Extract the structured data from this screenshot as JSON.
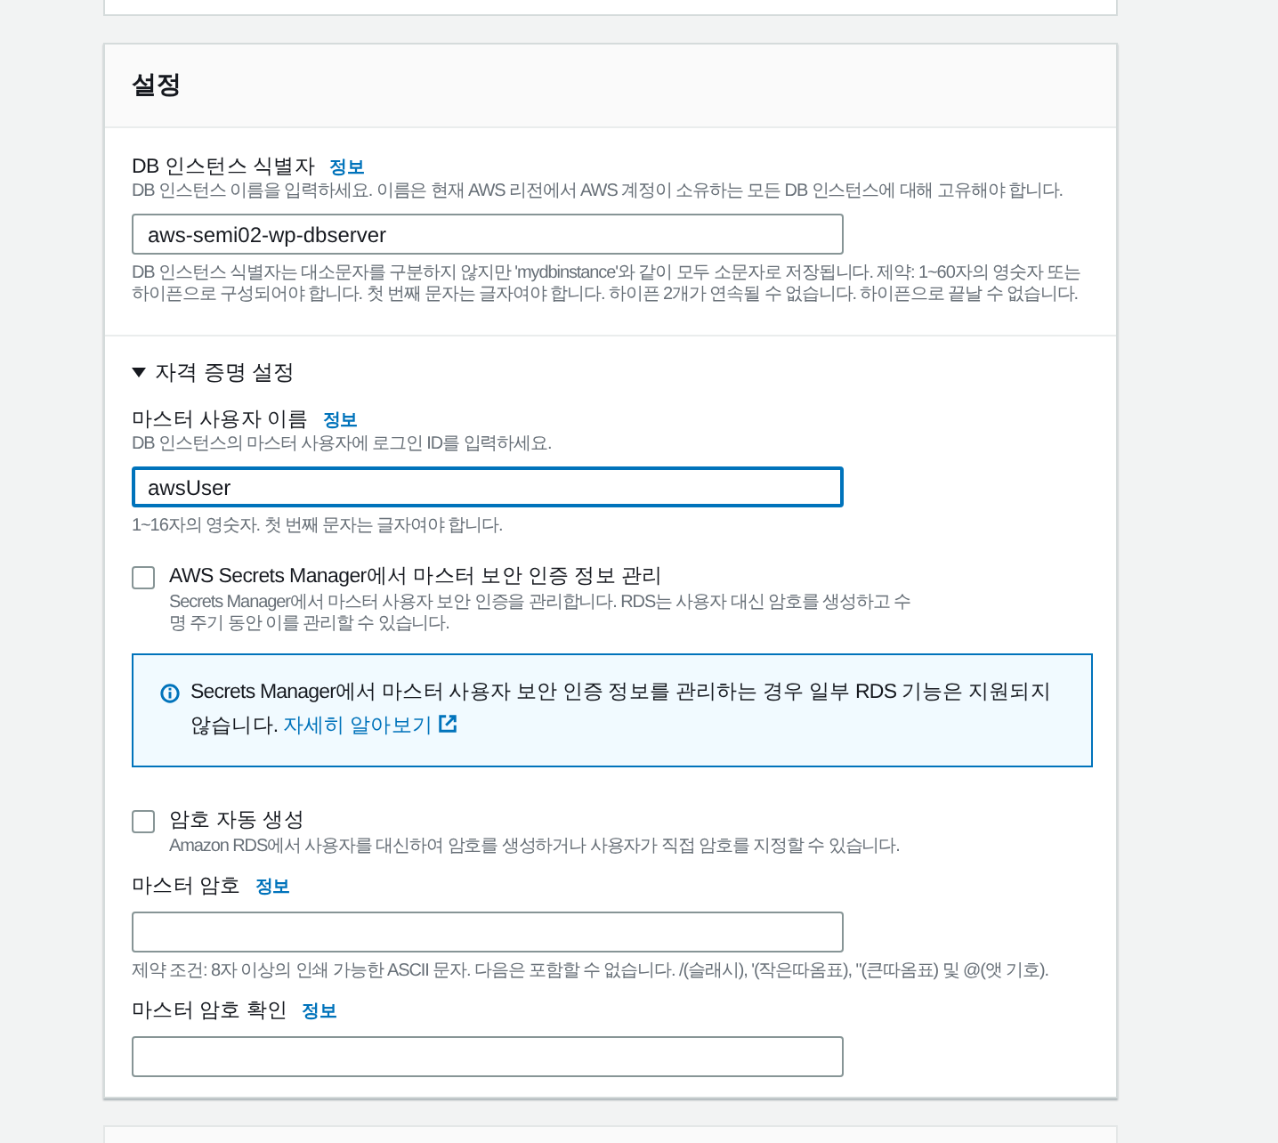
{
  "settings": {
    "title": "설정",
    "instance_identifier": {
      "label": "DB 인스턴스 식별자",
      "info": "정보",
      "description": "DB 인스턴스 이름을 입력하세요. 이름은 현재 AWS 리전에서 AWS 계정이 소유하는 모든 DB 인스턴스에 대해 고유해야 합니다.",
      "value": "aws-semi02-wp-dbserver",
      "focused": false,
      "constraint": "DB 인스턴스 식별자는 대소문자를 구분하지 않지만 'mydbinstance'와 같이 모두 소문자로 저장됩니다. 제약: 1~60자의 영숫자 또는 하이픈으로 구성되어야 합니다. 첫 번째 문자는 글자여야 합니다. 하이픈 2개가 연속될 수 없습니다. 하이픈으로 끝날 수 없습니다."
    },
    "credentials": {
      "title": "자격 증명 설정",
      "expanded": true,
      "items": [
        {
          "kind": "field",
          "label": "마스터 사용자 이름",
          "info": "정보",
          "description": "DB 인스턴스의 마스터 사용자에 로그인 ID를 입력하세요.",
          "value": "awsUser",
          "focused": true,
          "constraint": "1~16자의 영숫자. 첫 번째 문자는 글자여야 합니다."
        },
        {
          "kind": "checkbox",
          "label": "AWS Secrets Manager에서 마스터 보안 인증 정보 관리",
          "checked": false,
          "description": "Secrets Manager에서 마스터 사용자 보안 인증을 관리합니다. RDS는 사용자 대신 암호를 생성하고 수명 주기 동안 이를 관리할 수 있습니다."
        },
        {
          "kind": "alert",
          "text": "Secrets Manager에서 마스터 사용자 보안 인증 정보를 관리하는 경우 일부 RDS 기능은 지원되지 않습니다.",
          "link": "자세히 알아보기"
        },
        {
          "kind": "checkbox",
          "label": "암호 자동 생성",
          "checked": false,
          "description": "Amazon RDS에서 사용자를 대신하여 암호를 생성하거나 사용자가 직접 암호를 지정할 수 있습니다."
        },
        {
          "kind": "field",
          "label": "마스터 암호",
          "info": "정보",
          "focused": false,
          "constraint": "제약 조건: 8자 이상의 인쇄 가능한 ASCII 문자. 다음은 포함할 수 없습니다. /(슬래시), '(작은따옴표), \"(큰따옴표) 및 @(앳 기호)."
        },
        {
          "kind": "field",
          "label": "마스터 암호 확인",
          "info": "정보",
          "focused": false
        }
      ]
    }
  }
}
